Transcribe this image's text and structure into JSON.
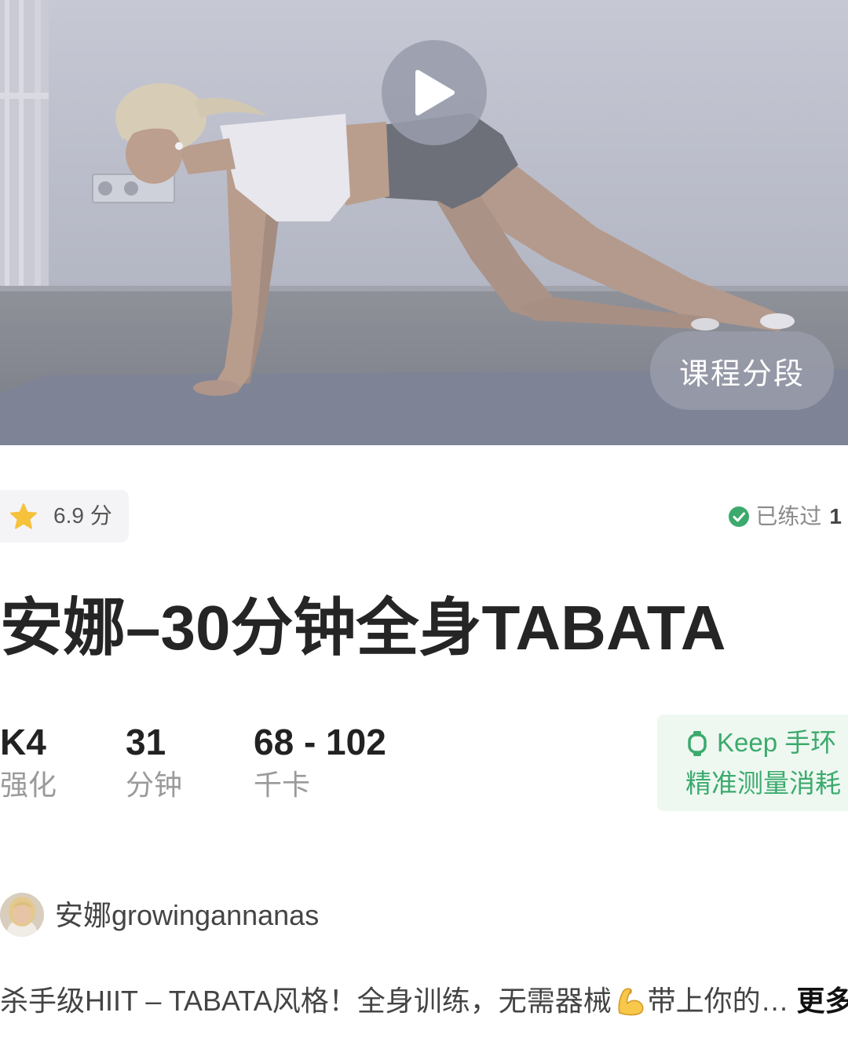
{
  "video": {
    "play_icon": "play-icon",
    "segments_button": "课程分段"
  },
  "rating": {
    "icon": "star-icon",
    "text": "6.9 分"
  },
  "practiced": {
    "icon": "check-circle-icon",
    "label": "已练过",
    "count": "1"
  },
  "title": "安娜–30分钟全身TABATA",
  "stats": [
    {
      "value": "K4",
      "label": "强化"
    },
    {
      "value": "31",
      "label": "分钟"
    },
    {
      "value": "68 - 102",
      "label": "千卡"
    }
  ],
  "band_promo": {
    "icon": "watch-icon",
    "line1": "Keep 手环",
    "line2": "精准测量消耗"
  },
  "author": {
    "name": "安娜growingannanas"
  },
  "description": {
    "text_before": "杀手级HIIT – TABATA风格！全身训练，无需器械",
    "emoji_icon": "flexed-biceps-icon",
    "text_after": "带上你的…",
    "more_link": "更多"
  },
  "colors": {
    "accent_green": "#3caa6d",
    "star_yellow": "#f6c13b",
    "title_text": "#252525",
    "muted_text": "#9a9a9a"
  }
}
